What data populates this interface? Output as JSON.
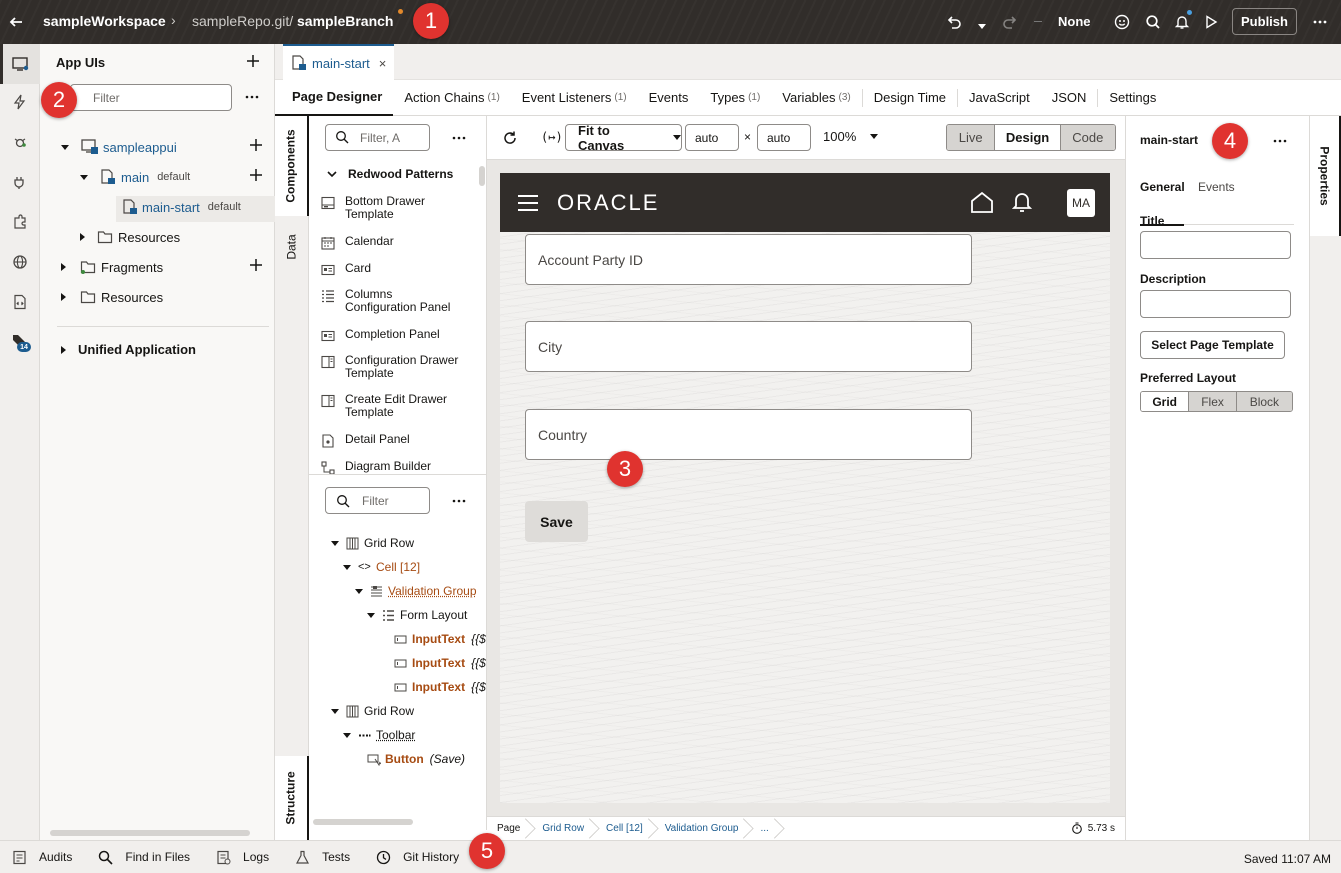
{
  "topbar": {
    "workspace": "sampleWorkspace",
    "repo": "sampleRepo.git/",
    "branch": "sampleBranch",
    "none_label": "None",
    "publish_label": "Publish"
  },
  "callouts": [
    "1",
    "2",
    "3",
    "4",
    "5"
  ],
  "app_panel": {
    "title": "App UIs",
    "filter_placeholder": "Filter",
    "tree": {
      "app": "sampleappui",
      "main": "main",
      "main_tag": "default",
      "main_start": "main-start",
      "main_start_tag": "default",
      "resources_inner": "Resources",
      "fragments": "Fragments",
      "resources": "Resources",
      "unified": "Unified Application"
    }
  },
  "rail": {
    "badge": "14"
  },
  "editor": {
    "file_tab": "main-start",
    "subtabs": [
      {
        "label": "Page Designer",
        "count": ""
      },
      {
        "label": "Action Chains",
        "count": "(1)"
      },
      {
        "label": "Event Listeners",
        "count": "(1)"
      },
      {
        "label": "Events",
        "count": ""
      },
      {
        "label": "Types",
        "count": "(1)"
      },
      {
        "label": "Variables",
        "count": "(3)"
      },
      {
        "label": "Design Time",
        "count": ""
      },
      {
        "label": "JavaScript",
        "count": ""
      },
      {
        "label": "JSON",
        "count": ""
      },
      {
        "label": "Settings",
        "count": ""
      }
    ],
    "side_tabs": {
      "components": "Components",
      "data": "Data",
      "structure": "Structure"
    }
  },
  "palette": {
    "filter_placeholder": "Filter, A",
    "group": "Redwood Patterns",
    "items": [
      {
        "l1": "Bottom Drawer",
        "l2": "Template"
      },
      {
        "l1": "Calendar",
        "l2": ""
      },
      {
        "l1": "Card",
        "l2": ""
      },
      {
        "l1": "Columns",
        "l2": "Configuration Panel"
      },
      {
        "l1": "Completion Panel",
        "l2": ""
      },
      {
        "l1": "Configuration Drawer",
        "l2": "Template"
      },
      {
        "l1": "Create Edit Drawer",
        "l2": "Template"
      },
      {
        "l1": "Detail Panel",
        "l2": ""
      },
      {
        "l1": "Diagram Builder",
        "l2": ""
      }
    ]
  },
  "structure": {
    "filter_placeholder": "Filter",
    "rows": [
      {
        "name": "Grid Row",
        "extra": ""
      },
      {
        "name": "Cell [12]",
        "extra": ""
      },
      {
        "name": "Validation Group",
        "extra": ""
      },
      {
        "name": "Form Layout",
        "extra": ""
      },
      {
        "name": "InputText",
        "extra": "{{$"
      },
      {
        "name": "InputText",
        "extra": "{{$"
      },
      {
        "name": "InputText",
        "extra": "{{$"
      },
      {
        "name": "Grid Row",
        "extra": ""
      },
      {
        "name": "Toolbar",
        "extra": ""
      },
      {
        "name": "Button",
        "extra": "(Save)"
      }
    ]
  },
  "canvas_toolbar": {
    "fit": "Fit to Canvas",
    "width": "auto",
    "times": "×",
    "height": "auto",
    "zoom": "100%",
    "modes": [
      "Live",
      "Design",
      "Code"
    ],
    "active_mode": "Design"
  },
  "preview": {
    "brand": "ORACLE",
    "avatar": "MA",
    "fields": [
      "Account Party ID",
      "City",
      "Country"
    ],
    "save": "Save"
  },
  "breadcrumbs": [
    "Page",
    "Grid Row",
    "Cell [12]",
    "Validation Group",
    "..."
  ],
  "timer": "5.73 s",
  "properties": {
    "title": "main-start",
    "rail_label": "Properties",
    "tabs": [
      "General",
      "Events"
    ],
    "title_label": "Title",
    "desc_label": "Description",
    "template_button": "Select Page Template",
    "layout_label": "Preferred Layout",
    "layouts": [
      "Grid",
      "Flex",
      "Block"
    ]
  },
  "bottombar": {
    "items": [
      "Audits",
      "Find in Files",
      "Logs",
      "Tests",
      "Git History"
    ],
    "status": "Saved 11:07 AM"
  },
  "colors": {
    "accent": "#312d2a",
    "callout": "#e0332f",
    "link": "#1d5c8f",
    "orange": "#a64b12"
  }
}
